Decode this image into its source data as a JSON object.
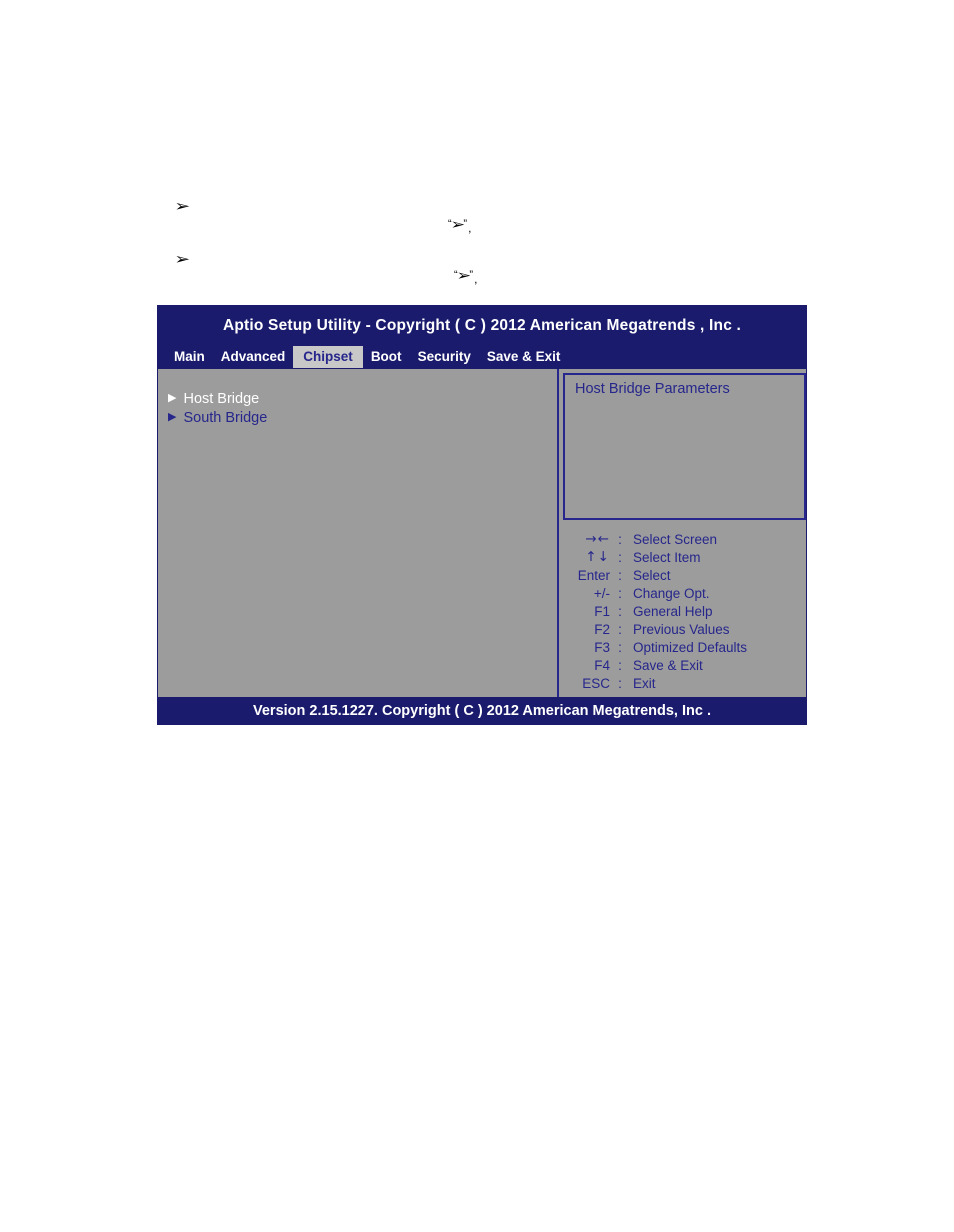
{
  "document": {
    "bullets": [
      {
        "marker": "➢",
        "text": ""
      },
      {
        "marker": "➢",
        "text": ""
      }
    ],
    "inline_quotes": [
      {
        "open": "“",
        "marker": "➢",
        "close": "”",
        "tail": ","
      },
      {
        "open": "“",
        "marker": "➢",
        "close": "”",
        "tail": ","
      }
    ]
  },
  "bios": {
    "title": "Aptio Setup Utility - Copyright ( C ) 2012 American Megatrends , Inc .",
    "tabs": [
      {
        "label": "Main",
        "active": false
      },
      {
        "label": "Advanced",
        "active": false
      },
      {
        "label": "Chipset",
        "active": true
      },
      {
        "label": "Boot",
        "active": false
      },
      {
        "label": "Security",
        "active": false
      },
      {
        "label": "Save & Exit",
        "active": false
      }
    ],
    "menu_items": [
      {
        "marker": "▶",
        "label": "Host Bridge",
        "selected": true
      },
      {
        "marker": "▶",
        "label": "South Bridge",
        "selected": false
      }
    ],
    "help": {
      "title": "Host Bridge Parameters",
      "body": ""
    },
    "legend": [
      {
        "key": "→←",
        "colon": ":",
        "label": "Select Screen",
        "arrows": true
      },
      {
        "key": "↑↓",
        "colon": ":",
        "label": "Select Item",
        "arrows": true
      },
      {
        "key": "Enter",
        "colon": ":",
        "label": "Select",
        "arrows": false
      },
      {
        "key": "+/-",
        "colon": ":",
        "label": "Change Opt.",
        "arrows": false
      },
      {
        "key": "F1",
        "colon": ":",
        "label": "General Help",
        "arrows": false
      },
      {
        "key": "F2",
        "colon": ":",
        "label": "Previous Values",
        "arrows": false
      },
      {
        "key": "F3",
        "colon": ":",
        "label": "Optimized Defaults",
        "arrows": false
      },
      {
        "key": "F4",
        "colon": ":",
        "label": "Save & Exit",
        "arrows": false
      },
      {
        "key": "ESC",
        "colon": ":",
        "label": "Exit",
        "arrows": false
      }
    ],
    "footer": "Version 2.15.1227. Copyright ( C ) 2012 American Megatrends, Inc .",
    "colors": {
      "window_blue": "#1b1b6e",
      "panel_gray": "#9c9c9c",
      "active_tab_gray": "#c8c8c8",
      "text_navy": "#26268c",
      "text_white": "#ffffff"
    }
  }
}
